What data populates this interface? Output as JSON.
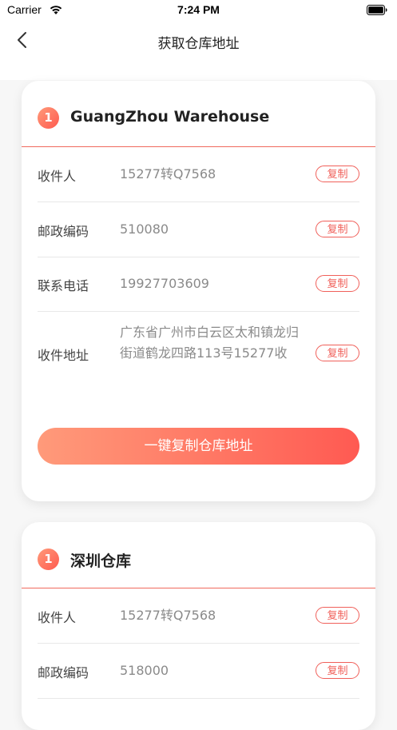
{
  "status_bar": {
    "carrier": "Carrier",
    "time": "7:24 PM",
    "icons": [
      "wifi-icon",
      "battery-icon"
    ]
  },
  "nav": {
    "title": "获取仓库地址",
    "back_icon": "chevron-left-icon"
  },
  "colors": {
    "accent": "#f0605a",
    "gradient_start": "#ff9a7a",
    "gradient_end": "#ff5a52"
  },
  "warehouses": [
    {
      "index": "1",
      "title": "GuangZhou Warehouse",
      "rows": [
        {
          "label": "收件人",
          "value": "15277转Q7568",
          "copy": "复制"
        },
        {
          "label": "邮政编码",
          "value": "510080",
          "copy": "复制"
        },
        {
          "label": "联系电话",
          "value": "19927703609",
          "copy": "复制"
        },
        {
          "label": "收件地址",
          "value": "广东省广州市白云区太和镇龙归街道鹤龙四路113号15277收",
          "copy": "复制"
        }
      ],
      "copy_all_label": "一键复制仓库地址"
    },
    {
      "index": "1",
      "title": "深圳仓库",
      "rows": [
        {
          "label": "收件人",
          "value": "15277转Q7568",
          "copy": "复制"
        },
        {
          "label": "邮政编码",
          "value": "518000",
          "copy": "复制"
        }
      ]
    }
  ]
}
